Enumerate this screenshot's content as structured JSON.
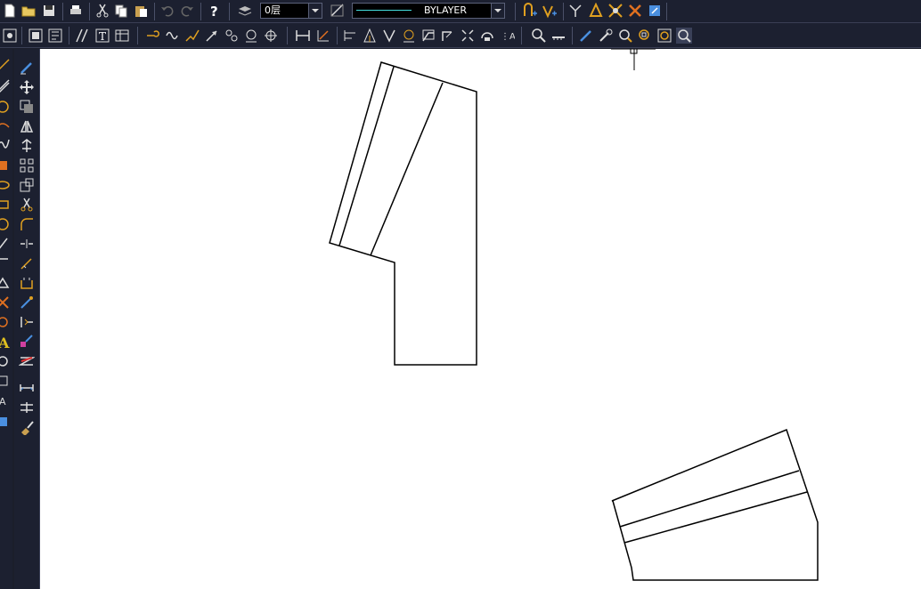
{
  "toolbar": {
    "layer_value": "0层",
    "linetype_value": "BYLAYER"
  },
  "colors": {
    "toolbar_bg": "#1c2030",
    "canvas_bg": "#ffffff",
    "stroke": "#000000",
    "icon_gold": "#e0a020",
    "icon_blue": "#4a8fe0"
  },
  "icons": {
    "row1": [
      "new-file-icon",
      "open-folder-icon",
      "save-icon",
      "print-icon",
      "cut-icon",
      "copy-icon",
      "paste-icon",
      "undo-icon",
      "redo-icon",
      "help-icon",
      "layer-manager-icon",
      "linetype-icon",
      "match-properties-icon",
      "properties-icon",
      "snap-icon",
      "object-snap-icon",
      "zoom-window-icon",
      "pan-icon"
    ],
    "row2": [
      "grid-icon",
      "text-style-icon",
      "insert-block-icon",
      "polyline-icon",
      "curve-icon",
      "dimension-linear-icon",
      "dimension-aligned-icon",
      "measure-icon",
      "zoom-realtime-icon",
      "zoom-previous-icon",
      "zoom-extents-icon",
      "zoom-all-icon"
    ],
    "left_draw": [
      "line-icon",
      "xline-icon",
      "circle-icon",
      "arc-icon",
      "spline-icon",
      "rectangle-icon",
      "ellipse-icon",
      "polygon-icon",
      "hatch-icon",
      "text-icon",
      "block-icon"
    ],
    "left_modify": [
      "erase-icon",
      "move-icon",
      "copy-object-icon",
      "mirror-icon",
      "rotate-icon",
      "array-icon",
      "scale-icon",
      "trim-icon",
      "fillet-icon",
      "break-icon",
      "extend-icon",
      "offset-icon",
      "explode-icon",
      "stretch-icon",
      "join-icon",
      "chamfer-icon",
      "lengthen-icon",
      "brush-icon"
    ]
  }
}
